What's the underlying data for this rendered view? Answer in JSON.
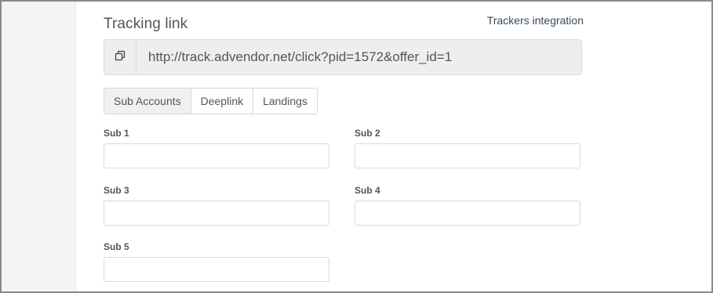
{
  "header": {
    "title": "Tracking link",
    "trackers_link": "Trackers integration"
  },
  "tracking_link": {
    "url": "http://track.advendor.net/click?pid=1572&offer_id=1",
    "copy_icon": "copy-icon"
  },
  "tabs": [
    {
      "label": "Sub Accounts",
      "active": true
    },
    {
      "label": "Deeplink",
      "active": false
    },
    {
      "label": "Landings",
      "active": false
    }
  ],
  "fields": [
    {
      "label": "Sub 1",
      "value": ""
    },
    {
      "label": "Sub 2",
      "value": ""
    },
    {
      "label": "Sub 3",
      "value": ""
    },
    {
      "label": "Sub 4",
      "value": ""
    },
    {
      "label": "Sub 5",
      "value": ""
    }
  ]
}
